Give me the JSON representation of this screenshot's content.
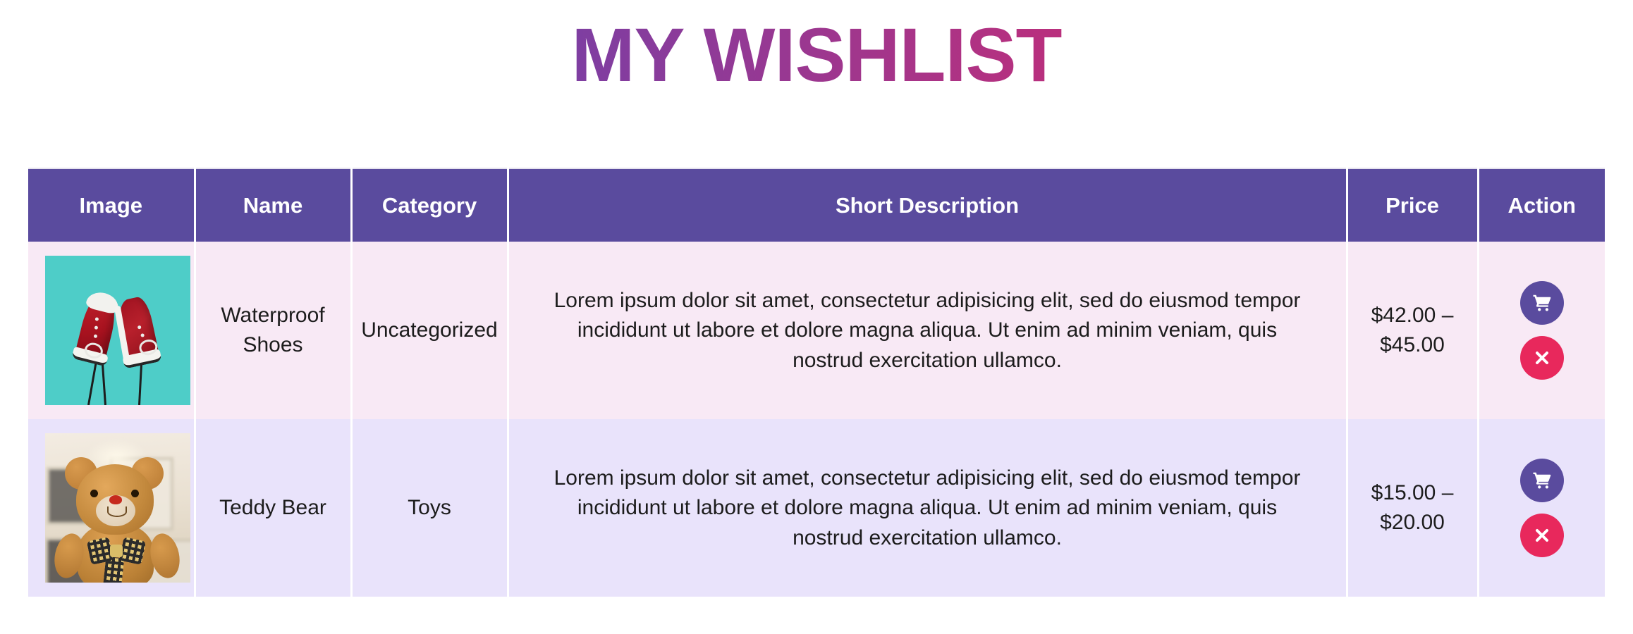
{
  "page": {
    "title": "MY WISHLIST",
    "title_gradient_start": "#4a46b4",
    "title_gradient_end": "#e8255f"
  },
  "table": {
    "header_bg": "#5a4b9e",
    "columns": [
      {
        "key": "image",
        "label": "Image"
      },
      {
        "key": "name",
        "label": "Name"
      },
      {
        "key": "category",
        "label": "Category"
      },
      {
        "key": "description",
        "label": "Short Description"
      },
      {
        "key": "price",
        "label": "Price"
      },
      {
        "key": "action",
        "label": "Action"
      }
    ],
    "rows": [
      {
        "row_bg": "#f8e9f5",
        "image_alt": "waterproof-shoes-photo",
        "name": "Waterproof Shoes",
        "category": "Uncategorized",
        "description": "Lorem ipsum dolor sit amet, consectetur adipisicing elit, sed do eiusmod tempor incididunt ut labore et dolore magna aliqua. Ut enim ad minim veniam, quis nostrud exercitation ullamco.",
        "price": "$42.00 – $45.00",
        "actions": {
          "add_to_cart": {
            "icon": "shopping-cart-icon",
            "color": "#5a4b9e"
          },
          "remove": {
            "icon": "close-x-icon",
            "color": "#e8285c"
          }
        }
      },
      {
        "row_bg": "#e9e3fb",
        "image_alt": "teddy-bear-photo",
        "name": "Teddy Bear",
        "category": "Toys",
        "description": "Lorem ipsum dolor sit amet, consectetur adipisicing elit, sed do eiusmod tempor incididunt ut labore et dolore magna aliqua. Ut enim ad minim veniam, quis nostrud exercitation ullamco.",
        "price": "$15.00 – $20.00",
        "actions": {
          "add_to_cart": {
            "icon": "shopping-cart-icon",
            "color": "#5a4b9e"
          },
          "remove": {
            "icon": "close-x-icon",
            "color": "#e8285c"
          }
        }
      }
    ]
  }
}
